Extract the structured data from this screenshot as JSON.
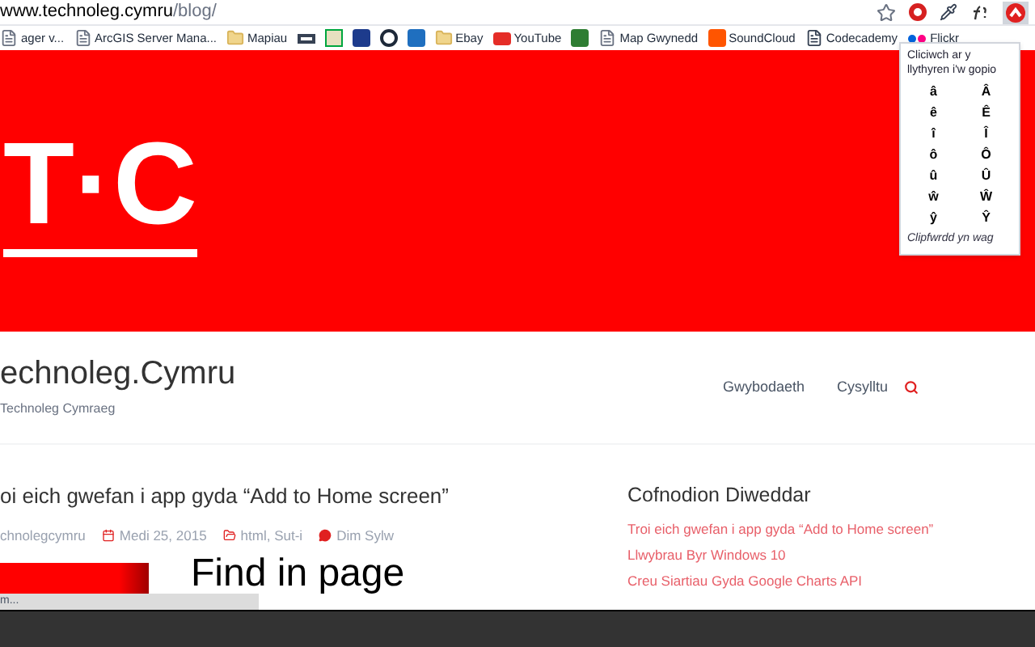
{
  "address_bar": {
    "url_host": "www.technoleg.cymru",
    "url_path": "/blog/"
  },
  "bookmarks": [
    {
      "label": "ager v...",
      "kind": "page"
    },
    {
      "label": "ArcGIS Server Mana...",
      "kind": "page"
    },
    {
      "label": "Mapiau",
      "kind": "folder"
    },
    {
      "kind": "app1"
    },
    {
      "kind": "app2"
    },
    {
      "kind": "app3"
    },
    {
      "kind": "app4"
    },
    {
      "kind": "app5"
    },
    {
      "label": "Ebay",
      "kind": "folder"
    },
    {
      "label": "YouTube",
      "kind": "youtube"
    },
    {
      "kind": "app6"
    },
    {
      "label": "Map Gwynedd",
      "kind": "page"
    },
    {
      "label": "SoundCloud",
      "kind": "soundcloud"
    },
    {
      "label": "Codecademy",
      "kind": "doc"
    },
    {
      "label": "Flickr",
      "kind": "flickr"
    }
  ],
  "extension_popup": {
    "instruction": "Cliciwch ar y llythyren i'w gopio",
    "letters": [
      [
        "â",
        "Â"
      ],
      [
        "ê",
        "Ê"
      ],
      [
        "î",
        "Î"
      ],
      [
        "ô",
        "Ô"
      ],
      [
        "û",
        "Û"
      ],
      [
        "ŵ",
        "Ŵ"
      ],
      [
        "ŷ",
        "Ŷ"
      ]
    ],
    "footer": "Clipfwrdd yn wag"
  },
  "hero": {
    "logo": "T·C"
  },
  "site": {
    "title": "echnoleg.Cymru",
    "tagline": "Technoleg Cymraeg",
    "nav": [
      "Gwybodaeth",
      "Cysylltu"
    ]
  },
  "post": {
    "title": "oi eich gwefan i app gyda “Add to Home screen”",
    "author": "chnolegcymru",
    "date": "Medi 25, 2015",
    "categories": "html, Sut-i",
    "comments": "Dim Sylw",
    "image_caption": "Find in page"
  },
  "sidebar": {
    "heading": "Cofnodion Diweddar",
    "links": [
      "Troi eich gwefan i app gyda “Add to Home screen”",
      "Llwybrau Byr Windows 10",
      "Creu Siartiau Gyda Google Charts API"
    ]
  },
  "status_bar": {
    "text": "m..."
  }
}
